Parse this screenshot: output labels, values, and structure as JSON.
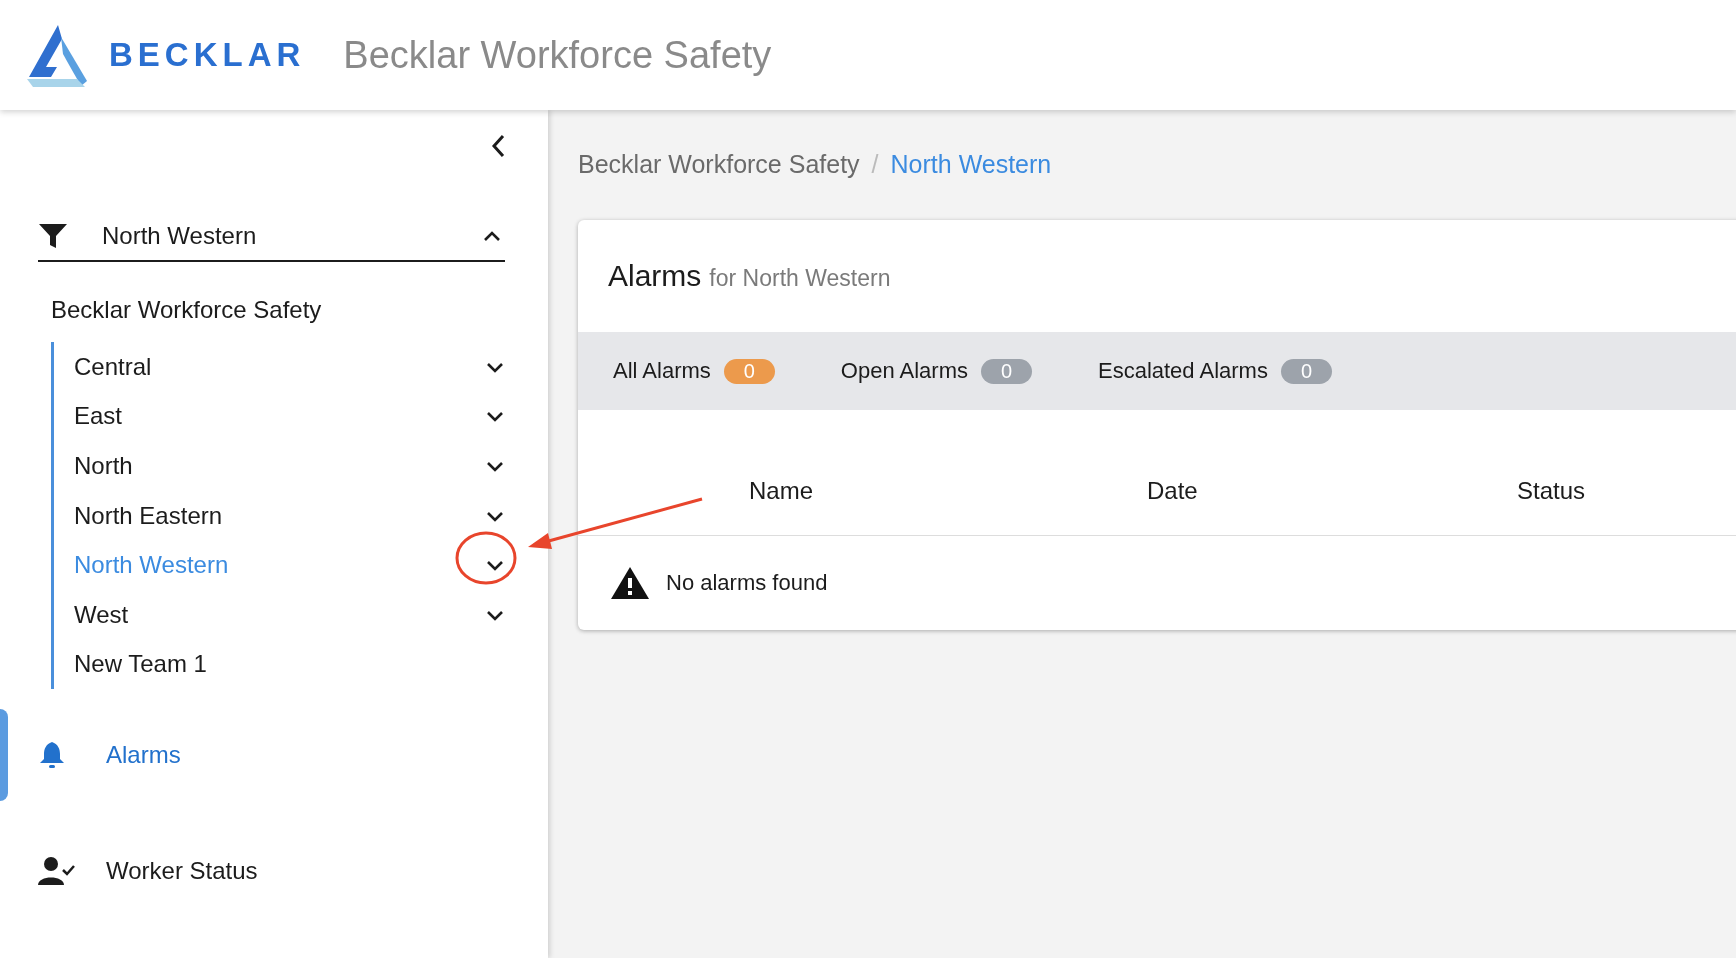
{
  "header": {
    "logo_text": "BECKLAR",
    "title": "Becklar Workforce Safety"
  },
  "sidebar": {
    "filter": {
      "value": "North Western",
      "expanded": true
    },
    "tree": {
      "label": "Becklar Workforce Safety",
      "children": [
        {
          "label": "Central",
          "selected": false,
          "has_children": true
        },
        {
          "label": "East",
          "selected": false,
          "has_children": true
        },
        {
          "label": "North",
          "selected": false,
          "has_children": true
        },
        {
          "label": "North Eastern",
          "selected": false,
          "has_children": true
        },
        {
          "label": "North Western",
          "selected": true,
          "has_children": true
        },
        {
          "label": "West",
          "selected": false,
          "has_children": true
        },
        {
          "label": "New Team 1",
          "selected": false,
          "has_children": false
        }
      ]
    },
    "nav": [
      {
        "label": "Alarms",
        "kind": "bell",
        "selected": true
      },
      {
        "label": "Worker Status",
        "kind": "person-check",
        "selected": false
      }
    ]
  },
  "breadcrumb": {
    "items": [
      {
        "label": "Becklar Workforce Safety",
        "current": false
      },
      {
        "label": "North Western",
        "current": true
      }
    ],
    "separator": "/"
  },
  "card": {
    "title": "Alarms",
    "subtitle": "for North Western",
    "tabs": [
      {
        "label": "All Alarms",
        "count": "0",
        "selected": true
      },
      {
        "label": "Open Alarms",
        "count": "0",
        "selected": false
      },
      {
        "label": "Escalated Alarms",
        "count": "0",
        "selected": false
      }
    ],
    "table": {
      "columns": [
        "Name",
        "Date",
        "Status"
      ],
      "empty_message": "No alarms found"
    }
  },
  "annotations": [
    {
      "kind": "circle"
    },
    {
      "kind": "arrow"
    }
  ]
}
